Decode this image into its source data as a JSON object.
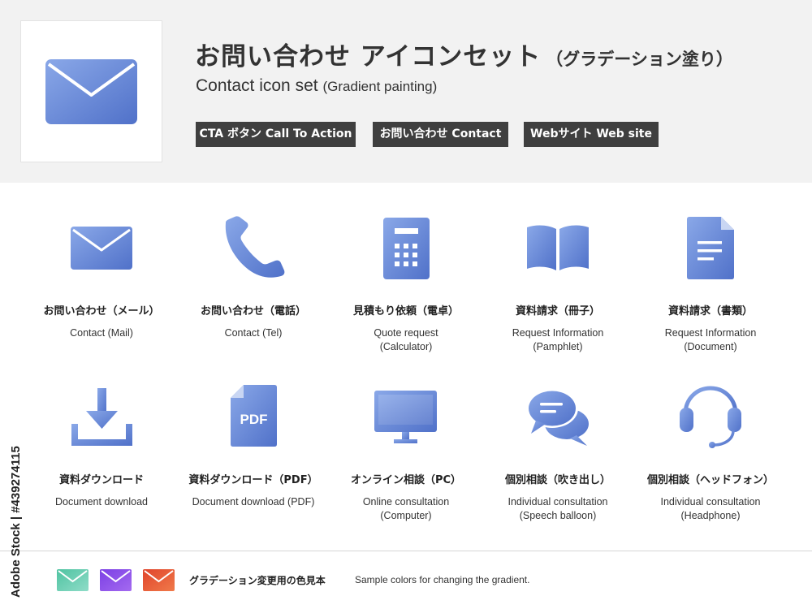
{
  "colors": {
    "gradient_light": "#8aa8e8",
    "gradient_dark": "#5071c9",
    "header_bg": "#f2f2f2",
    "tag_bg": "#3f3f3f"
  },
  "header": {
    "title_jp": "お問い合わせ アイコンセット",
    "title_jp_sub": "（グラデーション塗り）",
    "title_en": "Contact icon set",
    "title_en_sub": "(Gradient painting)",
    "tags": [
      "CTA ボタン Call To Action",
      "お問い合わせ Contact",
      "Webサイト Web site"
    ]
  },
  "icons": [
    {
      "icon": "mail-icon",
      "label_jp": "お問い合わせ（メール）",
      "label_en": "Contact (Mail)"
    },
    {
      "icon": "phone-icon",
      "label_jp": "お問い合わせ（電話）",
      "label_en": "Contact (Tel)"
    },
    {
      "icon": "calculator-icon",
      "label_jp": "見積もり依頼（電卓）",
      "label_en": "Quote request\n(Calculator)"
    },
    {
      "icon": "open-book-icon",
      "label_jp": "資料請求（冊子）",
      "label_en": "Request Information\n(Pamphlet)"
    },
    {
      "icon": "document-icon",
      "label_jp": "資料請求（書類）",
      "label_en": "Request Information\n(Document)"
    },
    {
      "icon": "download-icon",
      "label_jp": "資料ダウンロード",
      "label_en": "Document download"
    },
    {
      "icon": "pdf-file-icon",
      "pdf_text": "PDF",
      "label_jp": "資料ダウンロード（PDF）",
      "label_en": "Document download (PDF)"
    },
    {
      "icon": "monitor-icon",
      "label_jp": "オンライン相談（PC）",
      "label_en": "Online consultation\n(Computer)"
    },
    {
      "icon": "speech-balloon-icon",
      "label_jp": "個別相談（吹き出し）",
      "label_en": "Individual consultation\n(Speech balloon)"
    },
    {
      "icon": "headset-icon",
      "label_jp": "個別相談（ヘッドフォン）",
      "label_en": "Individual consultation\n(Headphone)"
    }
  ],
  "footer": {
    "swatches": [
      {
        "name": "teal-green",
        "from": "#4fc3a1",
        "to": "#8fdcc8"
      },
      {
        "name": "purple",
        "from": "#7b3fe4",
        "to": "#a46af0"
      },
      {
        "name": "orange-red",
        "from": "#e0442b",
        "to": "#f07a4a"
      }
    ],
    "label_jp": "グラデーション変更用の色見本",
    "label_en": "Sample colors for changing the gradient."
  },
  "stock_id": "Adobe Stock | #439274115"
}
